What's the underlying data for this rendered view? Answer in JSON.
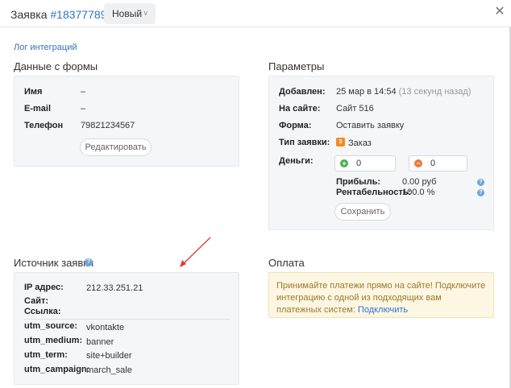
{
  "header": {
    "title_prefix": "Заявка",
    "order_number": "#18377789",
    "status": "Новый"
  },
  "log_link": "Лог интеграций",
  "form_section": {
    "title": "Данные с формы",
    "rows": [
      {
        "label": "Имя",
        "value": "–"
      },
      {
        "label": "E-mail",
        "value": "–"
      },
      {
        "label": "Телефон",
        "value": "79821234567"
      }
    ],
    "edit_button": "Редактировать"
  },
  "params_section": {
    "title": "Параметры",
    "added_label": "Добавлен:",
    "added_value": "25 мар в 14:54",
    "added_ago": "(13 секунд назад)",
    "site_label": "На сайте:",
    "site_value": "Сайт 516",
    "form_label": "Форма:",
    "form_value": "Оставить заявку",
    "type_label": "Тип заявки:",
    "type_value": "Заказ",
    "money_label": "Деньги:",
    "income_value": "0",
    "expense_value": "0",
    "profit_label": "Прибыль:",
    "profit_value": "0.00 руб",
    "margin_label": "Рентабельность:",
    "margin_value": "100.0 %",
    "save_button": "Сохранить"
  },
  "source_section": {
    "title": "Источник заявки",
    "ip_label": "IP адрес:",
    "ip_value": "212.33.251.21",
    "site_label": "Сайт:",
    "link_label": "Ссылка:",
    "utm": [
      {
        "label": "utm_source:",
        "value": "vkontakte"
      },
      {
        "label": "utm_medium:",
        "value": "banner"
      },
      {
        "label": "utm_term:",
        "value": "site+builder"
      },
      {
        "label": "utm_campaign:",
        "value": "march_sale"
      }
    ]
  },
  "payment_section": {
    "title": "Оплата",
    "notice_text": "Принимайте платежи прямо на сайте! Подключите интеграцию с одной из подходящих вам платежных систем:",
    "notice_link": "Подключить"
  },
  "colors": {
    "accent": "#2f73c8",
    "arrow": "#e03a2f",
    "income": "#4caf50",
    "expense": "#ef7a3a",
    "order_badge": "#f28c28"
  }
}
